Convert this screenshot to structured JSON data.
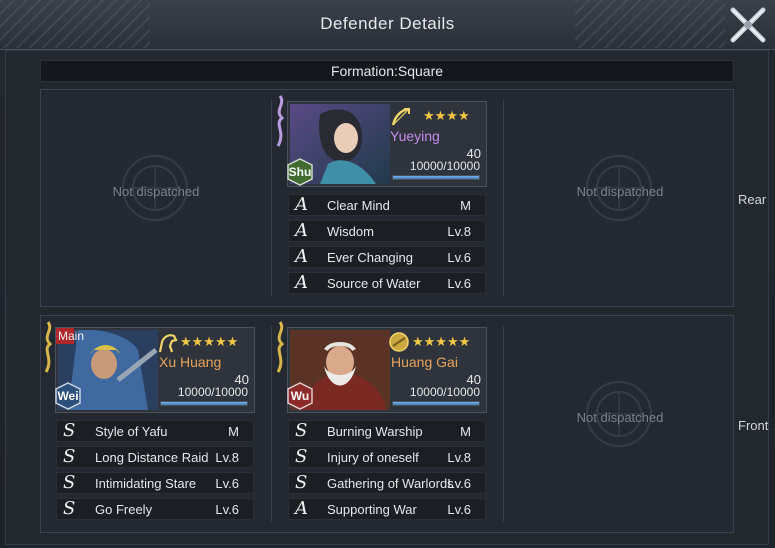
{
  "window": {
    "title": "Defender Details"
  },
  "formation": {
    "label": "Formation:Square"
  },
  "rows": {
    "rear_label": "Rear",
    "front_label": "Front"
  },
  "empty_slot_label": "Not dispatched",
  "heroes": {
    "yueying": {
      "name": "Yueying",
      "faction": "Shu",
      "stars": "★★★★",
      "level": "40",
      "troops": "10000/10000",
      "hp_fraction": 1.0,
      "weapon_icon": "bow-icon",
      "name_color": "#c58cf0",
      "skills": [
        {
          "grade": "A",
          "name": "Clear Mind",
          "lv": "M"
        },
        {
          "grade": "A",
          "name": "Wisdom",
          "lv": "Lv.8"
        },
        {
          "grade": "A",
          "name": "Ever Changing",
          "lv": "Lv.6"
        },
        {
          "grade": "A",
          "name": "Source of Water",
          "lv": "Lv.6"
        }
      ]
    },
    "xu_huang": {
      "name": "Xu Huang",
      "faction": "Wei",
      "main_badge": "Main",
      "stars": "★★★★★",
      "level": "40",
      "troops": "10000/10000",
      "hp_fraction": 1.0,
      "weapon_icon": "horse-icon",
      "name_color": "#e8a25a",
      "skills": [
        {
          "grade": "S",
          "name": "Style of Yafu",
          "lv": "M"
        },
        {
          "grade": "S",
          "name": "Long Distance Raid",
          "lv": "Lv.8"
        },
        {
          "grade": "S",
          "name": "Intimidating Stare",
          "lv": "Lv.6"
        },
        {
          "grade": "S",
          "name": "Go Freely",
          "lv": "Lv.6"
        }
      ]
    },
    "huang_gai": {
      "name": "Huang Gai",
      "faction": "Wu",
      "stars": "★★★★★",
      "level": "40",
      "troops": "10000/10000",
      "hp_fraction": 1.0,
      "weapon_icon": "shield-icon",
      "name_color": "#e8a25a",
      "skills": [
        {
          "grade": "S",
          "name": "Burning Warship",
          "lv": "M"
        },
        {
          "grade": "S",
          "name": "Injury of oneself",
          "lv": "Lv.8"
        },
        {
          "grade": "S",
          "name": "Gathering of Warlords",
          "lv": "Lv.6"
        },
        {
          "grade": "A",
          "name": "Supporting War",
          "lv": "Lv.6"
        }
      ]
    }
  },
  "colors": {
    "shu": "#3f6b2f",
    "wei": "#2d4f7c",
    "wu": "#8c2a2a",
    "star": "#f3c745"
  }
}
